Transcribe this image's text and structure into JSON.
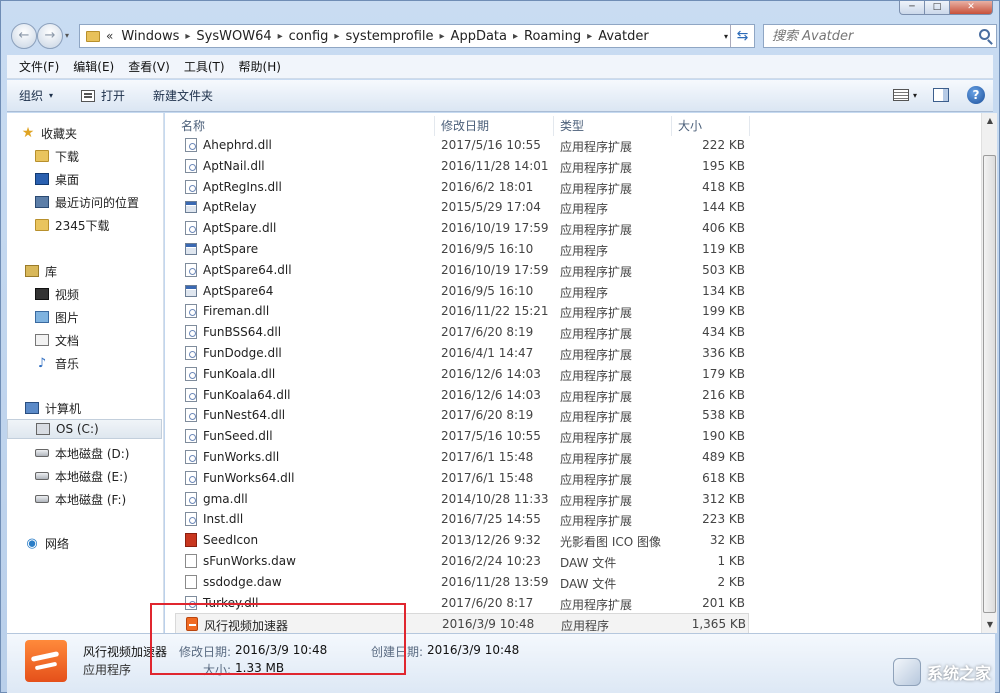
{
  "window": {
    "min_label": "─",
    "max_label": "□",
    "close_label": "✕"
  },
  "nav": {
    "back_glyph": "←",
    "forward_glyph": "→",
    "history_glyph": "▾"
  },
  "address": {
    "prefix": "«",
    "crumbs": [
      "Windows",
      "SysWOW64",
      "config",
      "systemprofile",
      "AppData",
      "Roaming",
      "Avatder"
    ],
    "separator": "▸",
    "dropdown_glyph": "▾",
    "refresh_glyph": "⇆"
  },
  "search": {
    "placeholder": "搜索 Avatder"
  },
  "menu": [
    "文件(F)",
    "编辑(E)",
    "查看(V)",
    "工具(T)",
    "帮助(H)"
  ],
  "toolbar": {
    "organize": "组织",
    "open": "打开",
    "new_folder": "新建文件夹",
    "dropdown_glyph": "▾",
    "help_glyph": "?"
  },
  "sidebar": {
    "favorites": {
      "label": "收藏夹",
      "items": [
        "下载",
        "桌面",
        "最近访问的位置",
        "2345下载"
      ]
    },
    "libraries": {
      "label": "库",
      "items": [
        "视频",
        "图片",
        "文档",
        "音乐"
      ]
    },
    "computer": {
      "label": "计算机",
      "items": [
        "OS (C:)",
        "本地磁盘 (D:)",
        "本地磁盘 (E:)",
        "本地磁盘 (F:)"
      ]
    },
    "network": {
      "label": "网络"
    },
    "glyphs": {
      "star": "★",
      "music": "♪",
      "network": "◉"
    }
  },
  "columns": {
    "name": "名称",
    "date": "修改日期",
    "type": "类型",
    "size": "大小"
  },
  "files": [
    {
      "name": "Ahephrd.dll",
      "date": "2017/5/16 10:55",
      "type": "应用程序扩展",
      "size": "222 KB",
      "icon": "dll"
    },
    {
      "name": "AptNail.dll",
      "date": "2016/11/28 14:01",
      "type": "应用程序扩展",
      "size": "195 KB",
      "icon": "dll"
    },
    {
      "name": "AptRegIns.dll",
      "date": "2016/6/2 18:01",
      "type": "应用程序扩展",
      "size": "418 KB",
      "icon": "dll"
    },
    {
      "name": "AptRelay",
      "date": "2015/5/29 17:04",
      "type": "应用程序",
      "size": "144 KB",
      "icon": "exe"
    },
    {
      "name": "AptSpare.dll",
      "date": "2016/10/19 17:59",
      "type": "应用程序扩展",
      "size": "406 KB",
      "icon": "dll"
    },
    {
      "name": "AptSpare",
      "date": "2016/9/5 16:10",
      "type": "应用程序",
      "size": "119 KB",
      "icon": "exe"
    },
    {
      "name": "AptSpare64.dll",
      "date": "2016/10/19 17:59",
      "type": "应用程序扩展",
      "size": "503 KB",
      "icon": "dll"
    },
    {
      "name": "AptSpare64",
      "date": "2016/9/5 16:10",
      "type": "应用程序",
      "size": "134 KB",
      "icon": "exe"
    },
    {
      "name": "Fireman.dll",
      "date": "2016/11/22 15:21",
      "type": "应用程序扩展",
      "size": "199 KB",
      "icon": "dll"
    },
    {
      "name": "FunBSS64.dll",
      "date": "2017/6/20 8:19",
      "type": "应用程序扩展",
      "size": "434 KB",
      "icon": "dll"
    },
    {
      "name": "FunDodge.dll",
      "date": "2016/4/1 14:47",
      "type": "应用程序扩展",
      "size": "336 KB",
      "icon": "dll"
    },
    {
      "name": "FunKoala.dll",
      "date": "2016/12/6 14:03",
      "type": "应用程序扩展",
      "size": "179 KB",
      "icon": "dll"
    },
    {
      "name": "FunKoala64.dll",
      "date": "2016/12/6 14:03",
      "type": "应用程序扩展",
      "size": "216 KB",
      "icon": "dll"
    },
    {
      "name": "FunNest64.dll",
      "date": "2017/6/20 8:19",
      "type": "应用程序扩展",
      "size": "538 KB",
      "icon": "dll"
    },
    {
      "name": "FunSeed.dll",
      "date": "2017/5/16 10:55",
      "type": "应用程序扩展",
      "size": "190 KB",
      "icon": "dll"
    },
    {
      "name": "FunWorks.dll",
      "date": "2017/6/1 15:48",
      "type": "应用程序扩展",
      "size": "489 KB",
      "icon": "dll"
    },
    {
      "name": "FunWorks64.dll",
      "date": "2017/6/1 15:48",
      "type": "应用程序扩展",
      "size": "618 KB",
      "icon": "dll"
    },
    {
      "name": "gma.dll",
      "date": "2014/10/28 11:33",
      "type": "应用程序扩展",
      "size": "312 KB",
      "icon": "dll"
    },
    {
      "name": "Inst.dll",
      "date": "2016/7/25 14:55",
      "type": "应用程序扩展",
      "size": "223 KB",
      "icon": "dll"
    },
    {
      "name": "SeedIcon",
      "date": "2013/12/26 9:32",
      "type": "光影看图 ICO 图像",
      "size": "32 KB",
      "icon": "ico"
    },
    {
      "name": "sFunWorks.daw",
      "date": "2016/2/24 10:23",
      "type": "DAW 文件",
      "size": "1 KB",
      "icon": "file"
    },
    {
      "name": "ssdodge.daw",
      "date": "2016/11/28 13:59",
      "type": "DAW 文件",
      "size": "2 KB",
      "icon": "file"
    },
    {
      "name": "Turkey.dll",
      "date": "2017/6/20 8:17",
      "type": "应用程序扩展",
      "size": "201 KB",
      "icon": "dll"
    },
    {
      "name": "风行视频加速器",
      "date": "2016/3/9 10:48",
      "type": "应用程序",
      "size": "1,365 KB",
      "icon": "app",
      "selected": true
    }
  ],
  "scrollbar": {
    "up_glyph": "▲",
    "down_glyph": "▼"
  },
  "details": {
    "name": "风行视频加速器",
    "type": "应用程序",
    "modified_label": "修改日期:",
    "modified_value": "2016/3/9 10:48",
    "size_label": "大小:",
    "size_value": "1.33 MB",
    "created_label": "创建日期:",
    "created_value": "2016/3/9 10:48"
  },
  "watermark": {
    "text": "系统之家"
  },
  "colors": {
    "highlight": "#e0262f",
    "title_bar": "#c9dcf2"
  }
}
